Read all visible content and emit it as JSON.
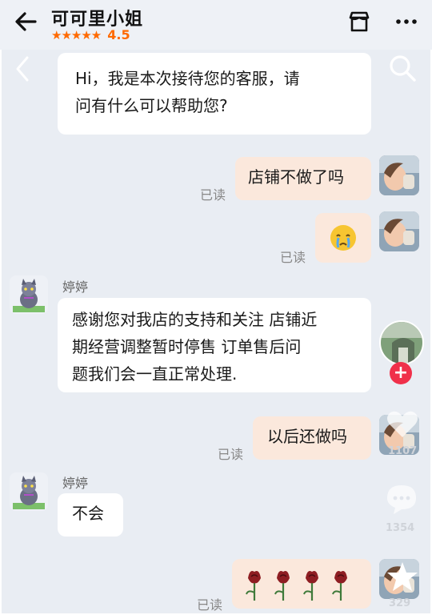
{
  "header": {
    "title": "可可里小姐",
    "stars": "★★★★★",
    "rating": "4.5"
  },
  "messages": [
    {
      "text_line1": "Hi，我是本次接待您的客服，请",
      "text_line2": "问有什么可以帮助您?"
    },
    {
      "text": "店铺不做了吗",
      "read": "已读"
    },
    {
      "read": "已读"
    },
    {
      "sender": "婷婷",
      "line1": "感谢您对我店的支持和关注 店铺近",
      "line2": "期经营调整暂时停售   订单售后问",
      "line3": "题我们会一直正常处理."
    },
    {
      "text": "以后还做吗",
      "read": "已读"
    },
    {
      "sender": "婷婷",
      "text": "不会"
    },
    {
      "read": "已读"
    }
  ],
  "side": {
    "count1": "1107",
    "count2": "1354",
    "count3": "329",
    "plus": "+"
  },
  "colors": {
    "accent": "#ff6a00",
    "outgoing_bubble": "#fbe8dc",
    "incoming_bubble": "#ffffff",
    "follow": "#f0304a"
  }
}
